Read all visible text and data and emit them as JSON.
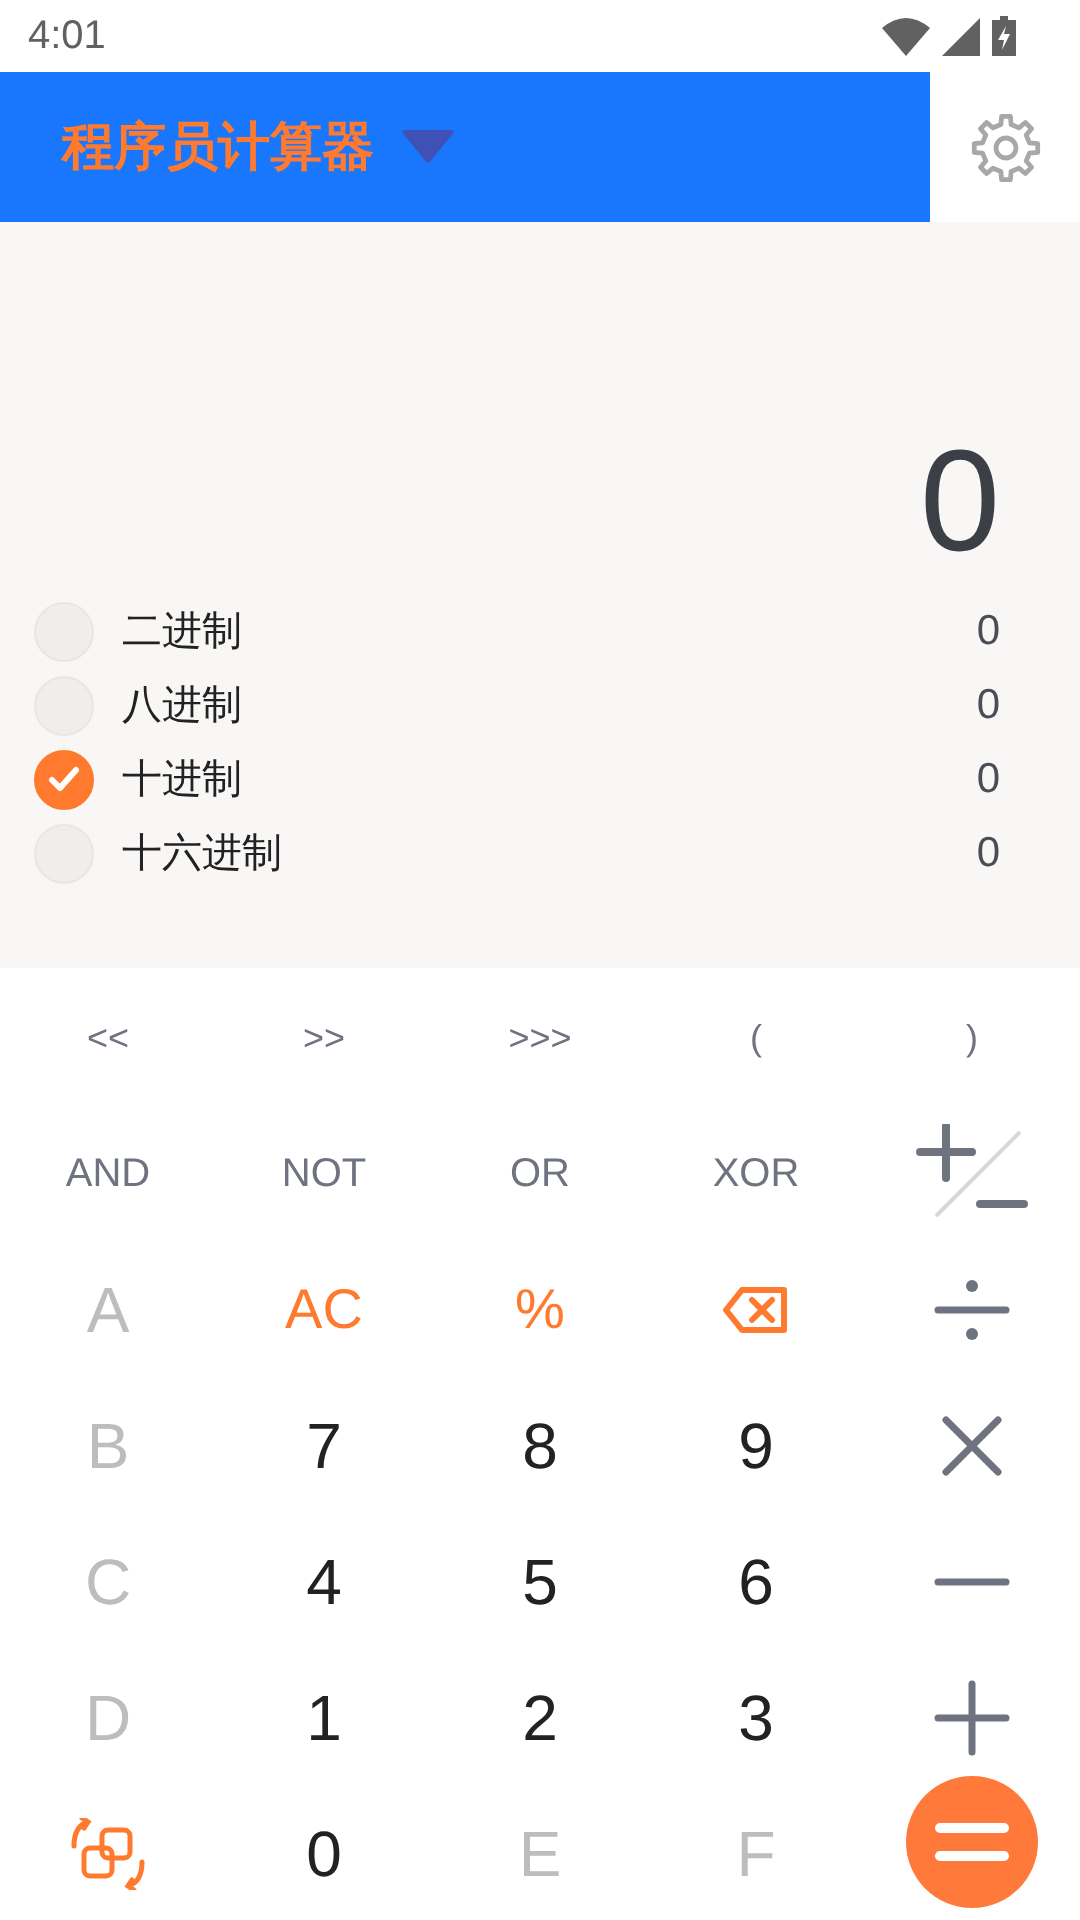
{
  "status_bar": {
    "time": "4:01"
  },
  "app_bar": {
    "title": "程序员计算器"
  },
  "display": {
    "value": "0"
  },
  "radixes": [
    {
      "label": "二进制",
      "value": "0",
      "selected": false
    },
    {
      "label": "八进制",
      "value": "0",
      "selected": false
    },
    {
      "label": "十进制",
      "value": "0",
      "selected": true
    },
    {
      "label": "十六进制",
      "value": "0",
      "selected": false
    }
  ],
  "keys": [
    {
      "kind": "small",
      "label": "<<"
    },
    {
      "kind": "small",
      "label": ">>"
    },
    {
      "kind": "small",
      "label": ">>>"
    },
    {
      "kind": "small",
      "label": "("
    },
    {
      "kind": "small",
      "label": ")"
    },
    {
      "kind": "op",
      "label": "AND"
    },
    {
      "kind": "op",
      "label": "NOT"
    },
    {
      "kind": "op",
      "label": "OR"
    },
    {
      "kind": "op",
      "label": "XOR"
    },
    {
      "kind": "plusminus"
    },
    {
      "kind": "digit",
      "label": "A",
      "disabled": true
    },
    {
      "kind": "accent",
      "label": "AC"
    },
    {
      "kind": "accent",
      "label": "%"
    },
    {
      "kind": "backspace"
    },
    {
      "kind": "divide"
    },
    {
      "kind": "digit",
      "label": "B",
      "disabled": true
    },
    {
      "kind": "digit",
      "label": "7",
      "disabled": false
    },
    {
      "kind": "digit",
      "label": "8",
      "disabled": false
    },
    {
      "kind": "digit",
      "label": "9",
      "disabled": false
    },
    {
      "kind": "multiply"
    },
    {
      "kind": "digit",
      "label": "C",
      "disabled": true
    },
    {
      "kind": "digit",
      "label": "4",
      "disabled": false
    },
    {
      "kind": "digit",
      "label": "5",
      "disabled": false
    },
    {
      "kind": "digit",
      "label": "6",
      "disabled": false
    },
    {
      "kind": "minus"
    },
    {
      "kind": "digit",
      "label": "D",
      "disabled": true
    },
    {
      "kind": "digit",
      "label": "1",
      "disabled": false
    },
    {
      "kind": "digit",
      "label": "2",
      "disabled": false
    },
    {
      "kind": "digit",
      "label": "3",
      "disabled": false
    },
    {
      "kind": "plus"
    },
    {
      "kind": "convert"
    },
    {
      "kind": "digit",
      "label": "0",
      "disabled": false
    },
    {
      "kind": "digit",
      "label": "E",
      "disabled": true
    },
    {
      "kind": "digit",
      "label": "F",
      "disabled": true
    },
    {
      "kind": "equals"
    }
  ]
}
